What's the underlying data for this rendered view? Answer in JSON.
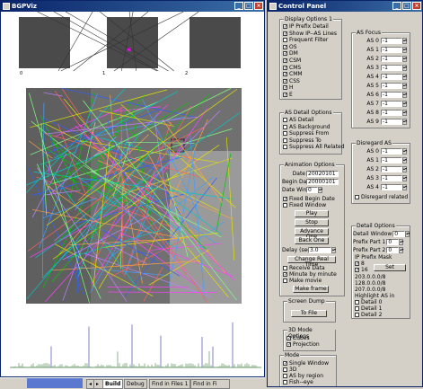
{
  "left_window": {
    "title": "BGPViz",
    "thumb_labels": [
      "0",
      "1",
      "2"
    ],
    "taskbar_tabs": [
      "Build",
      "Debug",
      "Find in Files 1",
      "Find in Fi"
    ]
  },
  "control_panel": {
    "title": "Control Panel",
    "display_options": {
      "title": "Display Options 1",
      "items": [
        {
          "label": "IP Prefix Detail",
          "checked": true
        },
        {
          "label": "Show IP--AS Lines",
          "checked": true
        },
        {
          "label": "Frequent Filter",
          "checked": false
        },
        {
          "label": "OS",
          "checked": true
        },
        {
          "label": "DM",
          "checked": true
        },
        {
          "label": "CSM",
          "checked": true
        },
        {
          "label": "CMS",
          "checked": true
        },
        {
          "label": "CMM",
          "checked": true
        },
        {
          "label": "CSS",
          "checked": true
        },
        {
          "label": "H",
          "checked": true
        },
        {
          "label": "E",
          "checked": true
        }
      ]
    },
    "as_detail": {
      "title": "AS Detail Options",
      "items": [
        {
          "label": "AS Detail",
          "checked": false
        },
        {
          "label": "AS Background",
          "checked": false
        },
        {
          "label": "Suppress From",
          "checked": false
        },
        {
          "label": "Suppress To",
          "checked": false
        },
        {
          "label": "Suppress All Related",
          "checked": false
        }
      ]
    },
    "animation": {
      "title": "Animation Options",
      "date_label": "Date",
      "date_value": "20020101",
      "begin_label": "Begin Date",
      "begin_value": "20000101",
      "window_label": "Date Window",
      "window_value": "0",
      "fixed_begin": "Fixed Begin Date",
      "fixed_begin_checked": true,
      "fixed_window": "Fixed Window",
      "fixed_window_checked": false,
      "play": "Play",
      "stop": "Stop",
      "advance": "Advance One",
      "back": "Back One",
      "delay_label": "Delay (secs)",
      "delay_value": "3.0",
      "change_real_time": "Change Real Time",
      "receive_data": "Receive Data",
      "receive_data_checked": false,
      "minute": "Minute by minute",
      "minute_checked": true,
      "make_movie": "Make movie",
      "make_movie_checked": false,
      "make_frame": "Make frame"
    },
    "screen_dump": {
      "title": "Screen Dump",
      "button": "To File"
    },
    "mode3d": {
      "title": "3D Mode Options",
      "items": [
        {
          "label": "Cubes",
          "checked": true
        },
        {
          "label": "Projection",
          "checked": true
        }
      ]
    },
    "mode": {
      "title": "Mode",
      "items": [
        {
          "label": "Single Window",
          "checked": true
        },
        {
          "label": "3D",
          "checked": false
        },
        {
          "label": "AS by region",
          "checked": false
        },
        {
          "label": "Fish--eye",
          "checked": false
        }
      ]
    },
    "as_focus": {
      "title": "AS Focus",
      "rows": [
        {
          "label": "AS 0",
          "value": "-1"
        },
        {
          "label": "AS 1",
          "value": "-1"
        },
        {
          "label": "AS 2",
          "value": "-1"
        },
        {
          "label": "AS 3",
          "value": "-1"
        },
        {
          "label": "AS 4",
          "value": "-1"
        },
        {
          "label": "AS 5",
          "value": "-1"
        },
        {
          "label": "AS 6",
          "value": "-1"
        },
        {
          "label": "AS 7",
          "value": "-1"
        },
        {
          "label": "AS 8",
          "value": "-1"
        },
        {
          "label": "AS 9",
          "value": "-1"
        }
      ]
    },
    "disregard": {
      "title": "Disregard AS",
      "rows": [
        {
          "label": "AS 0",
          "value": "-1"
        },
        {
          "label": "AS 1",
          "value": "-1"
        },
        {
          "label": "AS 2",
          "value": "-1"
        },
        {
          "label": "AS 3",
          "value": "-1"
        },
        {
          "label": "AS 4",
          "value": "-1"
        }
      ],
      "related": "Disregard related",
      "related_checked": false
    },
    "detail": {
      "title": "Detail Options",
      "window_label": "Detail Window",
      "window_value": "0",
      "p1_label": "Prefix Part 1",
      "p1_value": "0",
      "p2_label": "Prefix Part 2",
      "p2_value": "0",
      "mask_label": "IP Prefix Mask",
      "mask8": "8",
      "mask8_checked": true,
      "mask16": "16",
      "mask16_checked": true,
      "set": "Set",
      "ips": [
        "203.0.0.0/8",
        "128.0.0.0/8",
        "207.0.0.0/8"
      ],
      "highlight": "Highlight AS in",
      "levels": [
        {
          "label": "Detail 0",
          "checked": false
        },
        {
          "label": "Detail 1",
          "checked": false
        },
        {
          "label": "Detail 2",
          "checked": false
        }
      ]
    }
  }
}
